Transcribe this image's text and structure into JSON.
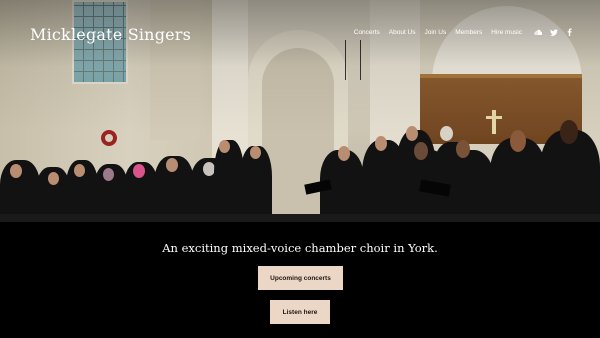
{
  "site": {
    "title": "Micklegate Singers"
  },
  "nav": {
    "items": [
      {
        "label": "Concerts"
      },
      {
        "label": "About Us"
      },
      {
        "label": "Join Us"
      },
      {
        "label": "Members"
      },
      {
        "label": "Hire music"
      }
    ]
  },
  "social": {
    "icons": [
      "soundcloud-icon",
      "twitter-icon",
      "facebook-icon"
    ]
  },
  "hero": {
    "image_alt": "choir-photo"
  },
  "main": {
    "tagline": "An exciting mixed-voice chamber choir in York.",
    "buttons": [
      {
        "label": "Upcoming concerts"
      },
      {
        "label": "Listen here"
      }
    ]
  },
  "colors": {
    "background": "#000000",
    "button_bg": "#ecd7c6",
    "button_text": "#1e1612"
  }
}
